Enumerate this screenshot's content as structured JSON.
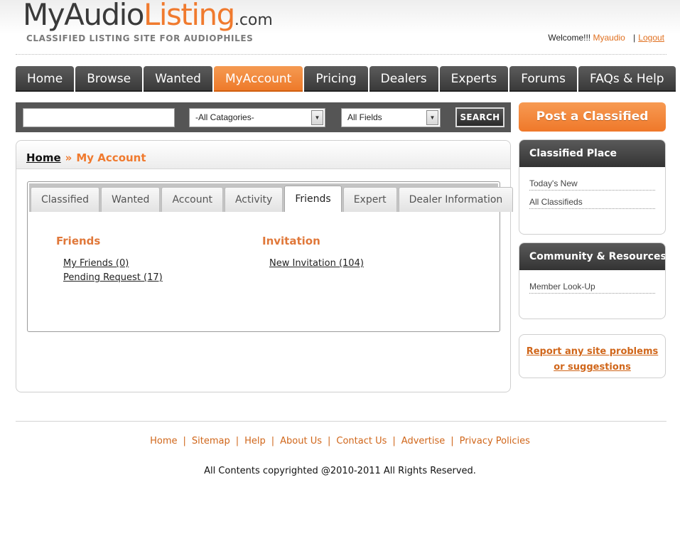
{
  "header": {
    "logo_part1": "MyAudio",
    "logo_part2": "Listing",
    "logo_suffix": ".com",
    "tagline": "CLASSIFIED LISTING SITE FOR AUDIOPHILES",
    "welcome_text": "Welcome!!!",
    "username": "Myaudio",
    "separator": "|",
    "logout_label": "Logout"
  },
  "nav": {
    "tabs": [
      {
        "label": "Home",
        "active": false
      },
      {
        "label": "Browse",
        "active": false
      },
      {
        "label": "Wanted",
        "active": false
      },
      {
        "label": "MyAccount",
        "active": true
      },
      {
        "label": "Pricing",
        "active": false
      },
      {
        "label": "Dealers",
        "active": false
      },
      {
        "label": "Experts",
        "active": false
      },
      {
        "label": "Forums",
        "active": false
      },
      {
        "label": "FAQs & Help",
        "active": false
      }
    ]
  },
  "search": {
    "query": "",
    "category_selected": "-All Catagories-",
    "field_selected": "All Fields",
    "button_label": "SEARCH"
  },
  "breadcrumb": {
    "home": "Home",
    "separator": "»",
    "current": "My Account"
  },
  "account_tabs": [
    {
      "label": "Classified",
      "active": false
    },
    {
      "label": "Wanted",
      "active": false
    },
    {
      "label": "Account",
      "active": false
    },
    {
      "label": "Activity",
      "active": false
    },
    {
      "label": "Friends",
      "active": true
    },
    {
      "label": "Expert",
      "active": false
    },
    {
      "label": "Dealer Information",
      "active": false
    }
  ],
  "friends_panel": {
    "friends_title": "Friends",
    "my_friends": "My Friends (0)",
    "pending_request": "Pending Request (17)",
    "invitation_title": "Invitation",
    "new_invitation": "New Invitation (104)"
  },
  "sidebar": {
    "post_button": "Post a Classified",
    "classified_place": {
      "title": "Classified Place",
      "items": [
        "Today's New",
        "All Classifieds"
      ]
    },
    "community": {
      "title": "Community & Resources",
      "items": [
        "Member Look-Up"
      ]
    },
    "report_line1": "Report any site problems",
    "report_line2": "or suggestions"
  },
  "footer": {
    "links": [
      "Home",
      "Sitemap",
      "Help",
      "About Us",
      "Contact Us",
      "Advertise",
      "Privacy Policies"
    ],
    "copyright": "All Contents copyrighted @2010-2011 All Rights Reserved."
  },
  "colors": {
    "accent": "#f07a2e",
    "nav_dark": "#3a3a3a",
    "link_orange": "#d0661a"
  }
}
